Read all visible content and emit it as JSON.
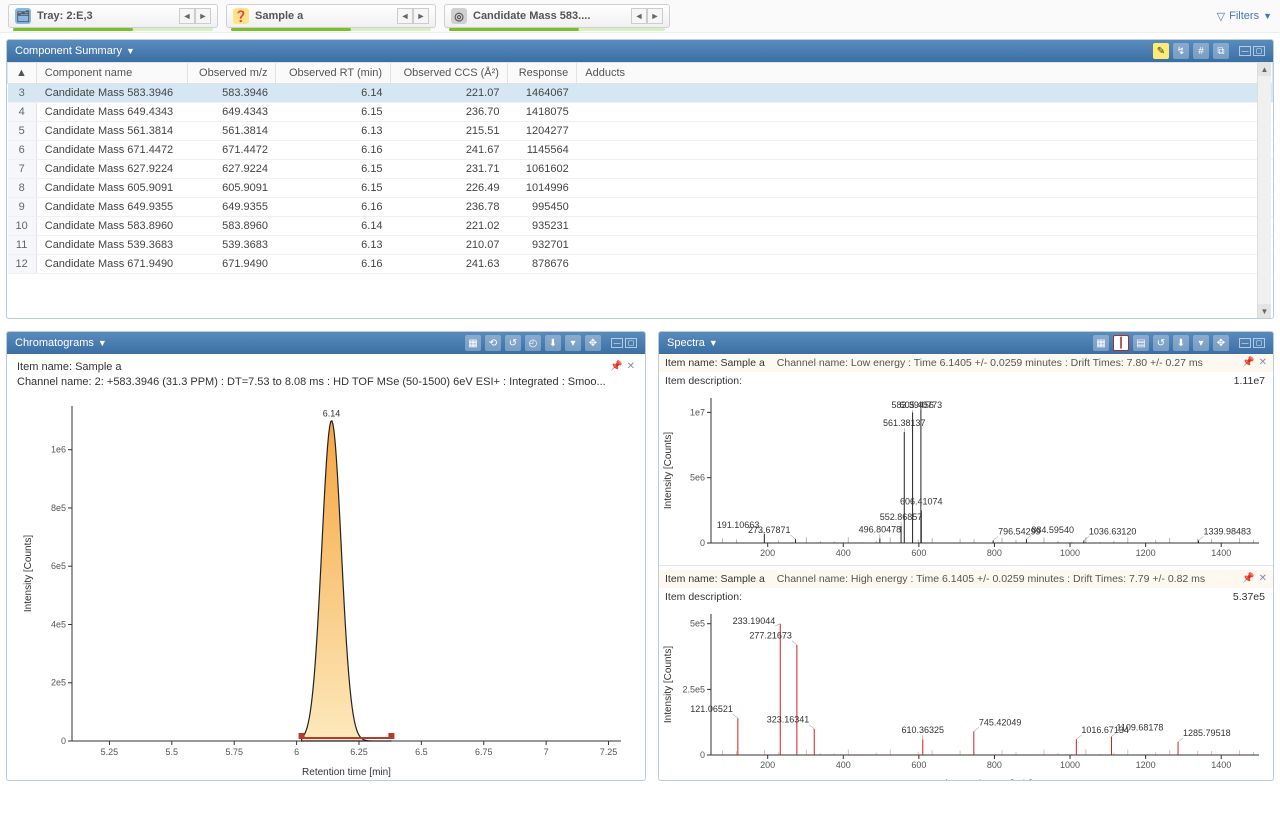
{
  "topbar": {
    "tray": {
      "label": "Tray: 2:E,3"
    },
    "sample": {
      "label": "Sample a"
    },
    "candidate": {
      "label": "Candidate Mass 583...."
    },
    "filters": "Filters"
  },
  "summary_panel": {
    "title": "Component Summary"
  },
  "columns": [
    "",
    "Component name",
    "Observed m/z",
    "Observed RT (min)",
    "Observed CCS (Å²)",
    "Response",
    "Adducts"
  ],
  "rows": [
    {
      "idx": 3,
      "name": "Candidate Mass 583.3946",
      "mz": "583.3946",
      "rt": "6.14",
      "ccs": "221.07",
      "resp": "1464067",
      "selected": true
    },
    {
      "idx": 4,
      "name": "Candidate Mass 649.4343",
      "mz": "649.4343",
      "rt": "6.15",
      "ccs": "236.70",
      "resp": "1418075"
    },
    {
      "idx": 5,
      "name": "Candidate Mass 561.3814",
      "mz": "561.3814",
      "rt": "6.13",
      "ccs": "215.51",
      "resp": "1204277"
    },
    {
      "idx": 6,
      "name": "Candidate Mass 671.4472",
      "mz": "671.4472",
      "rt": "6.16",
      "ccs": "241.67",
      "resp": "1145564"
    },
    {
      "idx": 7,
      "name": "Candidate Mass 627.9224",
      "mz": "627.9224",
      "rt": "6.15",
      "ccs": "231.71",
      "resp": "1061602"
    },
    {
      "idx": 8,
      "name": "Candidate Mass 605.9091",
      "mz": "605.9091",
      "rt": "6.15",
      "ccs": "226.49",
      "resp": "1014996"
    },
    {
      "idx": 9,
      "name": "Candidate Mass 649.9355",
      "mz": "649.9355",
      "rt": "6.16",
      "ccs": "236.78",
      "resp": "995450"
    },
    {
      "idx": 10,
      "name": "Candidate Mass 583.8960",
      "mz": "583.8960",
      "rt": "6.14",
      "ccs": "221.02",
      "resp": "935231"
    },
    {
      "idx": 11,
      "name": "Candidate Mass 539.3683",
      "mz": "539.3683",
      "rt": "6.13",
      "ccs": "210.07",
      "resp": "932701"
    },
    {
      "idx": 12,
      "name": "Candidate Mass 671.9490",
      "mz": "671.9490",
      "rt": "6.16",
      "ccs": "241.63",
      "resp": "878676"
    }
  ],
  "chrom": {
    "title": "Chromatograms",
    "item": "Item name: Sample a",
    "channel": "Channel name: 2: +583.3946 (31.3 PPM) : DT=7.53 to 8.08 ms : HD TOF MSe (50-1500) 6eV ESI+ : Integrated : Smoo...",
    "peak_label": "6.14",
    "ylabel": "Intensity [Counts]",
    "xlabel": "Retention time [min]"
  },
  "spectra": {
    "title": "Spectra",
    "low": {
      "item": "Item name: Sample a",
      "channel": "Channel name: Low energy : Time 6.1405 +/- 0.0259 minutes : Drift Times: 7.80 +/- 0.27 ms",
      "desc": "Item description:",
      "max": "1.11e7",
      "ylabel": "Intensity [Counts]"
    },
    "high": {
      "item": "Item name: Sample a",
      "channel": "Channel name: High energy : Time 6.1405 +/- 0.0259 minutes : Drift Times: 7.79 +/- 0.82 ms",
      "desc": "Item description:",
      "max": "5.37e5",
      "ylabel": "Intensity [Counts]",
      "xlabel": "Observed mass [m/z]"
    }
  },
  "chart_data": [
    {
      "type": "line",
      "name": "chromatogram",
      "xlabel": "Retention time [min]",
      "ylabel": "Intensity [Counts]",
      "xlim": [
        5.1,
        7.3
      ],
      "ylim": [
        0,
        1150000.0
      ],
      "xticks": [
        5.25,
        5.5,
        5.75,
        6,
        6.25,
        6.5,
        6.75,
        7,
        7.25
      ],
      "yticks": [
        0,
        200000.0,
        400000.0,
        600000.0,
        800000.0,
        1000000.0
      ],
      "ytick_labels": [
        "0",
        "2e5",
        "4e5",
        "6e5",
        "8e5",
        "1e6"
      ],
      "peak_apex_x": 6.14,
      "peak_apex_y": 1100000.0,
      "integration_range": [
        6.02,
        6.38
      ]
    },
    {
      "type": "bar",
      "name": "spectrum_low_energy",
      "xlabel": "Observed mass [m/z]",
      "ylabel": "Intensity [Counts]",
      "xlim": [
        50,
        1500
      ],
      "ylim": [
        0,
        11100000.0
      ],
      "xticks": [
        200,
        400,
        600,
        800,
        1000,
        1200,
        1400
      ],
      "yticks": [
        0,
        5000000.0,
        10000000.0
      ],
      "ytick_labels": [
        "0",
        "5e6",
        "1e7"
      ],
      "annotated_peaks": [
        {
          "mz": 191.10663,
          "intensity": 700000.0
        },
        {
          "mz": 273.67871,
          "intensity": 300000.0
        },
        {
          "mz": 496.80478,
          "intensity": 350000.0
        },
        {
          "mz": 552.86857,
          "intensity": 1300000.0
        },
        {
          "mz": 561.38137,
          "intensity": 8500000.0
        },
        {
          "mz": 583.39456,
          "intensity": 10000000.0
        },
        {
          "mz": 605.40773,
          "intensity": 10700000.0
        },
        {
          "mz": 606.41074,
          "intensity": 2500000.0
        },
        {
          "mz": 796.54299,
          "intensity": 200000.0
        },
        {
          "mz": 884.5954,
          "intensity": 300000.0
        },
        {
          "mz": 1036.6312,
          "intensity": 200000.0
        },
        {
          "mz": 1339.98483,
          "intensity": 200000.0
        }
      ]
    },
    {
      "type": "bar",
      "name": "spectrum_high_energy",
      "xlabel": "Observed mass [m/z]",
      "ylabel": "Intensity [Counts]",
      "xlim": [
        50,
        1500
      ],
      "ylim": [
        0,
        537000.0
      ],
      "xticks": [
        200,
        400,
        600,
        800,
        1000,
        1200,
        1400
      ],
      "yticks": [
        0,
        250000.0,
        500000.0
      ],
      "ytick_labels": [
        "0",
        "2.5e5",
        "5e5"
      ],
      "annotated_peaks": [
        {
          "mz": 121.06521,
          "intensity": 140000.0
        },
        {
          "mz": 233.19044,
          "intensity": 500000.0
        },
        {
          "mz": 277.21673,
          "intensity": 420000.0
        },
        {
          "mz": 323.16341,
          "intensity": 100000.0
        },
        {
          "mz": 610.36325,
          "intensity": 60000.0
        },
        {
          "mz": 745.42049,
          "intensity": 90000.0
        },
        {
          "mz": 1016.67134,
          "intensity": 60000.0
        },
        {
          "mz": 1109.68178,
          "intensity": 70000.0
        },
        {
          "mz": 1285.79518,
          "intensity": 50000.0
        }
      ]
    }
  ]
}
